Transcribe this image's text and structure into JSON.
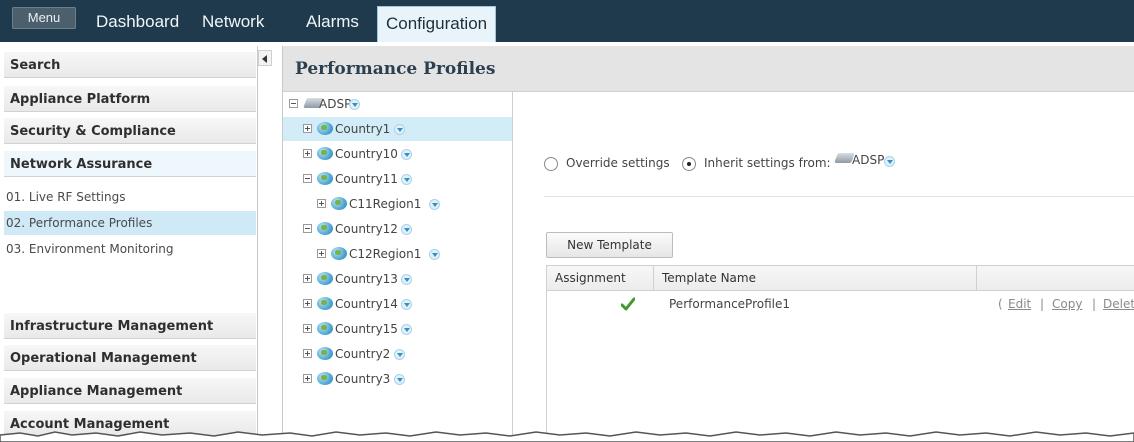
{
  "topnav": {
    "menu_label": "Menu",
    "tabs": [
      "Dashboard",
      "Network",
      "Alarms",
      "Configuration"
    ],
    "active_tab": "Configuration"
  },
  "sidebar": {
    "sections": {
      "search": "Search",
      "appliance_platform": "Appliance Platform",
      "security_compliance": "Security & Compliance",
      "network_assurance": "Network Assurance",
      "infrastructure_management": "Infrastructure Management",
      "operational_management": "Operational Management",
      "appliance_management": "Appliance Management",
      "account_management": "Account Management"
    },
    "items": [
      "01. Live RF Settings",
      "02. Performance Profiles",
      "03. Environment Monitoring"
    ],
    "selected_item": "02. Performance Profiles"
  },
  "panel": {
    "title": "Performance Profiles"
  },
  "tree": {
    "root": "ADSP",
    "nodes": [
      {
        "label": "Country1",
        "expanded": false
      },
      {
        "label": "Country10",
        "expanded": false
      },
      {
        "label": "Country11",
        "expanded": true
      },
      {
        "label": "C11Region1",
        "expanded": false
      },
      {
        "label": "Country12",
        "expanded": true
      },
      {
        "label": "C12Region1",
        "expanded": false
      },
      {
        "label": "Country13",
        "expanded": false
      },
      {
        "label": "Country14",
        "expanded": false
      },
      {
        "label": "Country15",
        "expanded": false
      },
      {
        "label": "Country2",
        "expanded": false
      },
      {
        "label": "Country3",
        "expanded": false
      }
    ],
    "selected": "Country1"
  },
  "settings": {
    "override_label": "Override settings",
    "inherit_label": "Inherit settings from:",
    "inherit_source": "ADSP",
    "selected_option": "inherit"
  },
  "templates": {
    "new_button": "New Template",
    "columns": [
      "Assignment",
      "Template Name"
    ],
    "rows": [
      {
        "assigned": true,
        "name": "PerformanceProfile1"
      }
    ],
    "actions": {
      "open": "(",
      "edit": "Edit",
      "sep1": "|",
      "copy": "Copy",
      "sep2": "|",
      "delete": "Delete"
    }
  },
  "colors": {
    "topbar": "#1f3a4d",
    "selection": "#cfe9f6",
    "check": "#3f9a2c"
  }
}
